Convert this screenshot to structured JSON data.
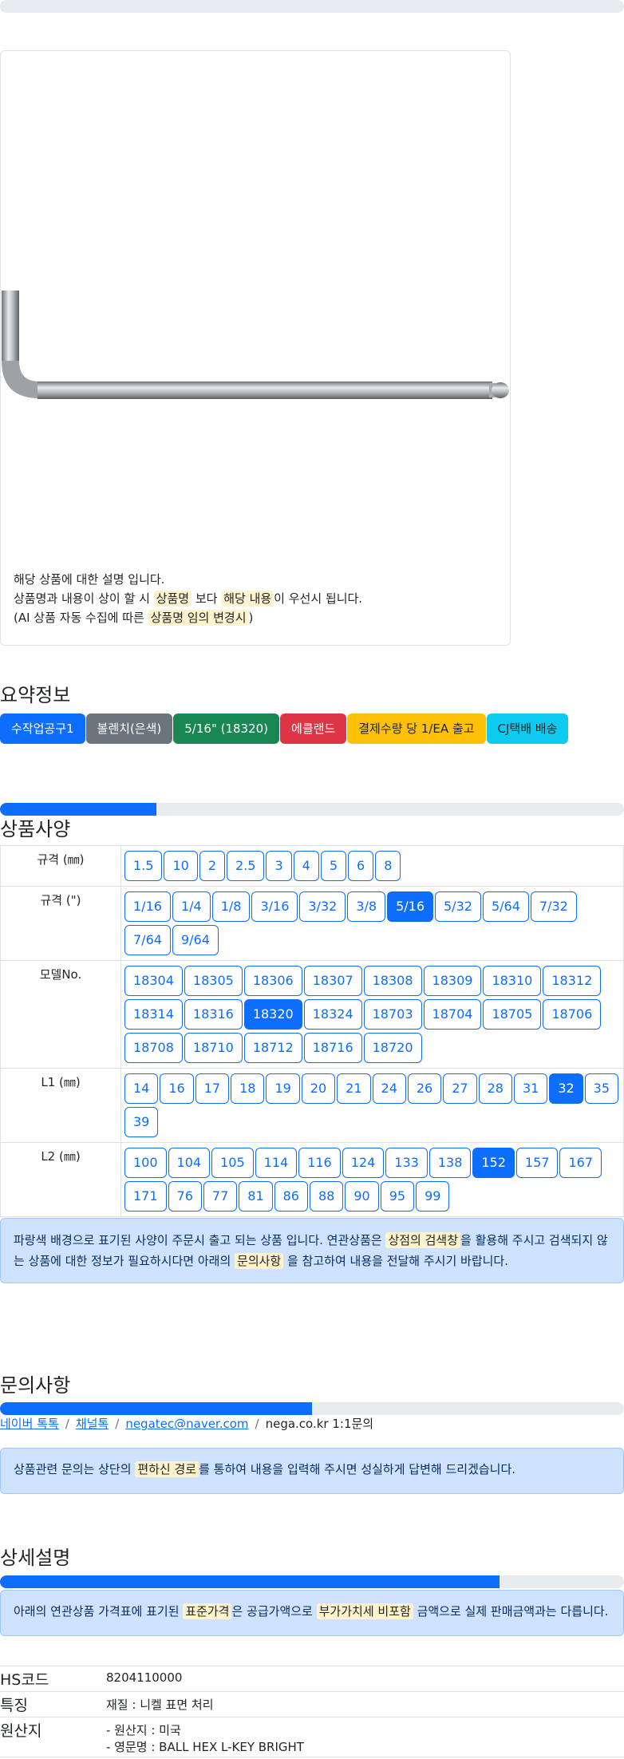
{
  "product_image": {
    "desc_line1": "해당 상품에 대한 설명 입니다.",
    "desc_line2_a": "상품명과 내용이 상이 할 시 ",
    "desc_line2_mark1": "상품명",
    "desc_line2_b": " 보다 ",
    "desc_line2_mark2": "해당 내용",
    "desc_line2_c": "이 우선시 됩니다.",
    "desc_line3_a": "(AI 상품 자동 수집에 따른 ",
    "desc_line3_mark": "상품명 임의 변경시",
    "desc_line3_b": ")"
  },
  "summary": {
    "title": "요약정보",
    "badges": [
      {
        "label": "수작업공구1",
        "color": "#0d6efd"
      },
      {
        "label": "볼렌치(은색)",
        "color": "#6c757d"
      },
      {
        "label": "5/16\" (18320)",
        "color": "#198754"
      },
      {
        "label": "에클랜드",
        "color": "#dc3545"
      },
      {
        "label": "결제수량 당 1/EA 출고",
        "color": "#ffc107",
        "text_color": "#212529"
      },
      {
        "label": "CJ택배 배송",
        "color": "#0dcaf0",
        "text_color": "#212529"
      }
    ]
  },
  "spec": {
    "progress": 25,
    "title": "상품사양",
    "rows": [
      {
        "label": "규격 (㎜)",
        "options": [
          "1.5",
          "10",
          "2",
          "2.5",
          "3",
          "4",
          "5",
          "6",
          "8"
        ],
        "active": ""
      },
      {
        "label": "규격 (\")",
        "options": [
          "1/16",
          "1/4",
          "1/8",
          "3/16",
          "3/32",
          "3/8",
          "5/16",
          "5/32",
          "5/64",
          "7/32",
          "7/64",
          "9/64"
        ],
        "active": "5/16"
      },
      {
        "label": "모델No.",
        "options": [
          "18304",
          "18305",
          "18306",
          "18307",
          "18308",
          "18309",
          "18310",
          "18312",
          "18314",
          "18316",
          "18320",
          "18324",
          "18703",
          "18704",
          "18705",
          "18706",
          "18708",
          "18710",
          "18712",
          "18716",
          "18720"
        ],
        "active": "18320"
      },
      {
        "label": "L1 (㎜)",
        "options": [
          "14",
          "16",
          "17",
          "18",
          "19",
          "20",
          "21",
          "24",
          "26",
          "27",
          "28",
          "31",
          "32",
          "35",
          "39"
        ],
        "active": "32"
      },
      {
        "label": "L2 (㎜)",
        "options": [
          "100",
          "104",
          "105",
          "114",
          "116",
          "124",
          "133",
          "138",
          "152",
          "157",
          "167",
          "171",
          "76",
          "77",
          "81",
          "86",
          "88",
          "90",
          "95",
          "99"
        ],
        "active": "152"
      }
    ],
    "notice_a": "파랑색 배경으로 표기된 사양이 주문시 출고 되는 상품 입니다. 연관상품은 ",
    "notice_mark1": "상점의 검색창",
    "notice_b": "을 활용해 주시고 검색되지 않는 상품에 대한 정보가 필요하시다면 아래의 ",
    "notice_mark2": "문의사항",
    "notice_c": " 을 참고하여 내용을 전달해 주시기 바랍니다."
  },
  "inquiry": {
    "title": "문의사항",
    "progress": 50,
    "link1": "네이버 톡톡",
    "link2": "채널톡",
    "link3": "negatec@naver.com",
    "sep": "/",
    "plain": "nega.co.kr 1:1문의",
    "notice_a": "상품관련 문의는 상단의 ",
    "notice_mark": "편하신 경로",
    "notice_b": "를 통하여 내용을 입력해 주시면 성실하게 답변해 드리겠습니다."
  },
  "detail": {
    "title": "상세설명",
    "progress": 80,
    "notice_a": "아래의 연관상품 가격표에 표기된 ",
    "notice_mark1": "표준가격",
    "notice_b": "은 공급가액으로 ",
    "notice_mark2": "부가가치세 비포함",
    "notice_c": " 금액으로 실제 판매금액과는 다릅니다."
  },
  "info": {
    "hs_label": "HS코드",
    "hs_value": "8204110000",
    "feature_label": "특징",
    "feature_value": "재질 : 니켈 표면 처리",
    "origin_label": "원산지",
    "origin_line1": "- 원산지 : 미국",
    "origin_line2": "- 영문명 : BALL HEX L-KEY BRIGHT"
  }
}
